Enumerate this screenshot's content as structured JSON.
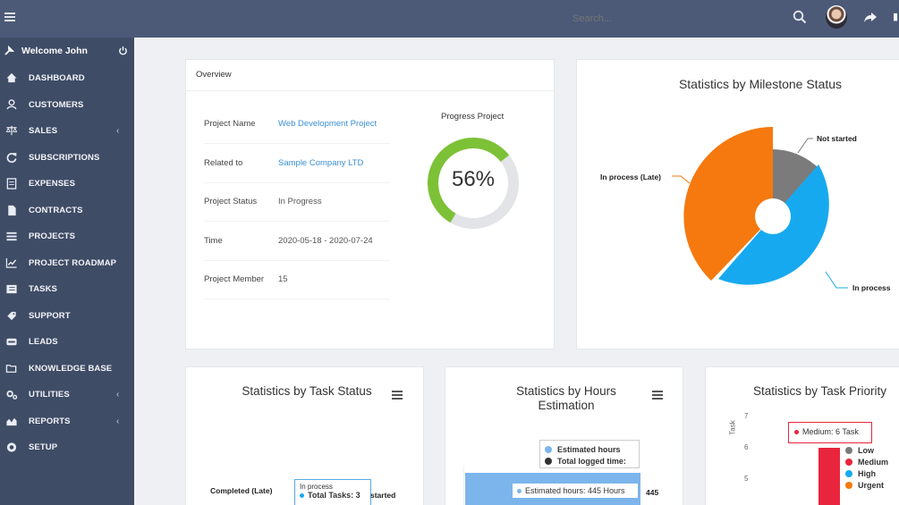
{
  "topbar": {
    "search_placeholder": "Search...",
    "icons": [
      "menu-icon",
      "search-icon",
      "share-icon"
    ]
  },
  "sidebar": {
    "welcome": "Welcome John",
    "items": [
      {
        "label": "DASHBOARD",
        "icon": "home-icon",
        "has_sub": false
      },
      {
        "label": "CUSTOMERS",
        "icon": "user-icon",
        "has_sub": false
      },
      {
        "label": "SALES",
        "icon": "balance-icon",
        "has_sub": true
      },
      {
        "label": "SUBSCRIPTIONS",
        "icon": "refresh-icon",
        "has_sub": false
      },
      {
        "label": "EXPENSES",
        "icon": "file-text-icon",
        "has_sub": false
      },
      {
        "label": "CONTRACTS",
        "icon": "file-icon",
        "has_sub": false
      },
      {
        "label": "PROJECTS",
        "icon": "bars-icon",
        "has_sub": false
      },
      {
        "label": "PROJECT ROADMAP",
        "icon": "line-chart-icon",
        "has_sub": false
      },
      {
        "label": "TASKS",
        "icon": "tasks-icon",
        "has_sub": false
      },
      {
        "label": "SUPPORT",
        "icon": "ticket-icon",
        "has_sub": false
      },
      {
        "label": "LEADS",
        "icon": "tty-icon",
        "has_sub": false
      },
      {
        "label": "KNOWLEDGE BASE",
        "icon": "folder-open-icon",
        "has_sub": false
      },
      {
        "label": "UTILITIES",
        "icon": "cogs-icon",
        "has_sub": true
      },
      {
        "label": "REPORTS",
        "icon": "area-chart-icon",
        "has_sub": true
      },
      {
        "label": "SETUP",
        "icon": "cog-icon",
        "has_sub": false
      }
    ],
    "chevron": "‹"
  },
  "overview": {
    "title": "Overview",
    "rows": [
      {
        "key": "Project Name",
        "value": "Web Development Project",
        "link": true
      },
      {
        "key": "Related to",
        "value": "Sample Company LTD",
        "link": true
      },
      {
        "key": "Project Status",
        "value": "In Progress",
        "link": false
      },
      {
        "key": "Time",
        "value": "2020-05-18 - 2020-07-24",
        "link": false
      },
      {
        "key": "Project Member",
        "value": "15",
        "link": false
      }
    ],
    "progress_title": "Progress Project",
    "progress_label": "56%",
    "progress_value": 0.56,
    "colors": {
      "progress": "#7cc136",
      "track": "#e2e4e8"
    }
  },
  "milestone": {
    "title": "Statistics by Milestone Status",
    "labels": {
      "not_started": "Not started",
      "in_process_late": "In process (Late)",
      "in_process": "In process"
    },
    "colors": {
      "not_started": "#7b7b7b",
      "in_process_late": "#f5790e",
      "in_process": "#17a9ef"
    }
  },
  "task_status": {
    "title": "Statistics by Task Status",
    "label_completed_late": "Completed (Late)",
    "label_started": "started",
    "tooltip_title": "In process",
    "tooltip_value": "Total Tasks: 3"
  },
  "hours": {
    "title": "Statistics by Hours Estimation",
    "legend": [
      {
        "label": "Estimated hours",
        "color": "#7cb5ec"
      },
      {
        "label": "Total logged time:",
        "color": "#333333"
      }
    ],
    "tooltip": "Estimated hours: 445 Hours",
    "bar_label": "445",
    "estimated_hours": 445
  },
  "priority": {
    "title": "Statistics by Task Priority",
    "y_axis_label": "Task",
    "y_ticks": [
      "7",
      "6",
      "5"
    ],
    "tooltip": "Medium: 6 Task",
    "medium_value": 6,
    "legend": [
      {
        "label": "Low",
        "color": "#7b7b7b"
      },
      {
        "label": "Medium",
        "color": "#e8253c"
      },
      {
        "label": "High",
        "color": "#17a9ef"
      },
      {
        "label": "Urgent",
        "color": "#f5790e"
      }
    ]
  },
  "chart_data": [
    {
      "type": "pie",
      "title": "Statistics by Milestone Status",
      "categories": [
        "Not started",
        "In process",
        "In process (Late)"
      ],
      "values": [
        10,
        44,
        46
      ]
    },
    {
      "type": "bar",
      "title": "Statistics by Hours Estimation",
      "categories": [
        "Estimated hours"
      ],
      "values": [
        445
      ]
    },
    {
      "type": "bar",
      "title": "Statistics by Task Priority",
      "categories": [
        "Medium"
      ],
      "values": [
        6
      ],
      "ylabel": "Task"
    }
  ]
}
